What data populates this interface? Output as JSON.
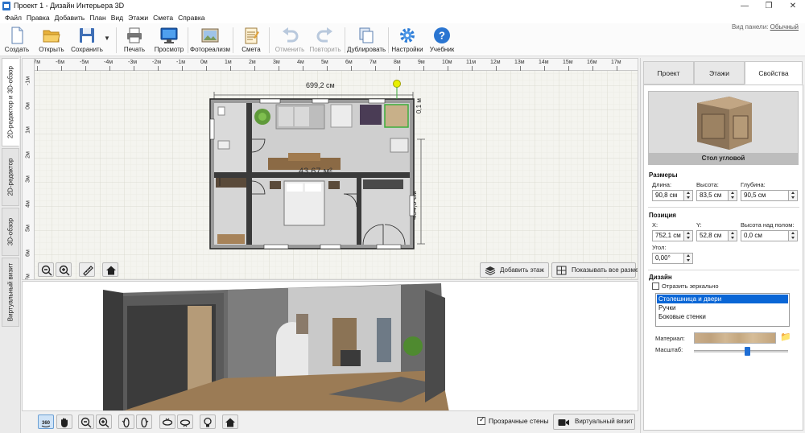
{
  "window": {
    "title": "Проект 1 - Дизайн Интерьера 3D",
    "controls": [
      "—",
      "❐",
      "✕"
    ]
  },
  "menu": [
    "Файл",
    "Правка",
    "Добавить",
    "План",
    "Вид",
    "Этажи",
    "Смета",
    "Справка"
  ],
  "toolbar": {
    "buttons": [
      {
        "label": "Создать",
        "icon": "new-file-icon",
        "enabled": true
      },
      {
        "label": "Открыть",
        "icon": "folder-open-icon",
        "enabled": true
      },
      {
        "label": "Сохранить",
        "icon": "floppy-disk-icon",
        "enabled": true
      },
      {
        "label": "Печать",
        "icon": "printer-icon",
        "enabled": true
      },
      {
        "label": "Просмотр",
        "icon": "monitor-icon",
        "enabled": true
      },
      {
        "label": "Фотореализм",
        "icon": "photo-icon",
        "enabled": true
      },
      {
        "label": "Смета",
        "icon": "notepad-icon",
        "enabled": true
      },
      {
        "label": "Отменить",
        "icon": "undo-icon",
        "enabled": false
      },
      {
        "label": "Повторить",
        "icon": "redo-icon",
        "enabled": false
      },
      {
        "label": "Дублировать",
        "icon": "duplicate-icon",
        "enabled": true
      },
      {
        "label": "Настройки",
        "icon": "gear-icon",
        "enabled": true
      },
      {
        "label": "Учебник",
        "icon": "help-icon",
        "enabled": true
      }
    ],
    "panel_view_label": "Вид панели:",
    "panel_view_value": "Обычный"
  },
  "left_tabs": [
    {
      "label": "2D-редактор и 3D-обзор",
      "active": true
    },
    {
      "label": "2D-редактор",
      "active": false
    },
    {
      "label": "3D-обзор",
      "active": false
    },
    {
      "label": "Виртуальный визит",
      "active": false
    }
  ],
  "editor2d": {
    "ruler_top": [
      "-7м",
      "-6м",
      "-5м",
      "-4м",
      "-3м",
      "-2м",
      "-1м",
      "0м",
      "1м",
      "2м",
      "3м",
      "4м",
      "5м",
      "6м",
      "7м",
      "8м",
      "9м",
      "10м",
      "11м",
      "12м",
      "13м",
      "14м",
      "15м",
      "16м",
      "17м"
    ],
    "ruler_left": [
      "-1м",
      "0м",
      "1м",
      "2м",
      "3м",
      "4м",
      "5м",
      "6м",
      "7м"
    ],
    "dim_width": "699,2 см",
    "dim_height": "484,5 см",
    "dim_small": "0,1 м",
    "area_label": "43,67 м²",
    "add_floor_label": "Добавить этаж",
    "show_dims_label": "Показывать все размеры",
    "tools": [
      "zoom-out-icon",
      "zoom-in-icon",
      "ruler-icon",
      "home-icon"
    ]
  },
  "bottom_bar": {
    "transparent_walls_label": "Прозрачные стены",
    "transparent_walls_checked": true,
    "virtual_visit_label": "Виртуальный визит",
    "tools": [
      "view-360-icon",
      "hand-pan-icon",
      "zoom-out-icon",
      "zoom-in-icon",
      "rotate-left-icon",
      "rotate-right-icon",
      "tilt-up-icon",
      "tilt-down-icon",
      "light-bulb-icon",
      "home-icon"
    ]
  },
  "right_panel": {
    "tabs": [
      {
        "label": "Проект",
        "active": false
      },
      {
        "label": "Этажи",
        "active": false
      },
      {
        "label": "Свойства",
        "active": true
      }
    ],
    "object_name": "Стол угловой",
    "sizes": {
      "title": "Размеры",
      "length_label": "Длина:",
      "length_value": "90,8 см",
      "height_label": "Высота:",
      "height_value": "83,5 см",
      "depth_label": "Глубина:",
      "depth_value": "90,5 см"
    },
    "position": {
      "title": "Позиция",
      "x_label": "X:",
      "x_value": "752,1 см",
      "y_label": "Y:",
      "y_value": "52,8 см",
      "elev_label": "Высота над полом:",
      "elev_value": "0,0 см",
      "angle_label": "Угол:",
      "angle_value": "0,00°"
    },
    "design": {
      "title": "Дизайн",
      "mirror_label": "Отразить зеркально",
      "mirror_checked": false,
      "parts": [
        "Столешница и двери",
        "Ручки",
        "Боковые стенки"
      ],
      "selected_part": 0,
      "material_label": "Материал:",
      "scale_label": "Масштаб:",
      "scale_level": 0.57
    }
  }
}
